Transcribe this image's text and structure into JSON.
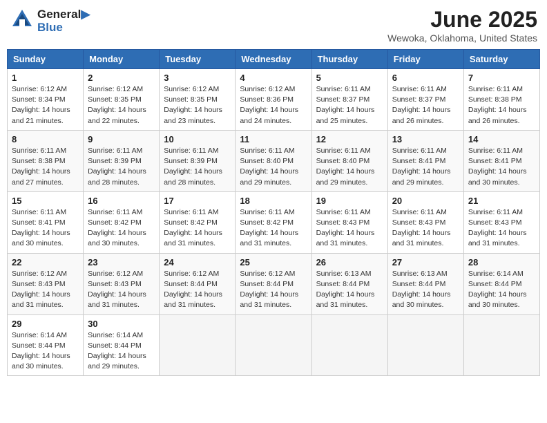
{
  "header": {
    "logo_line1": "General",
    "logo_line2": "Blue",
    "month_title": "June 2025",
    "location": "Wewoka, Oklahoma, United States"
  },
  "weekdays": [
    "Sunday",
    "Monday",
    "Tuesday",
    "Wednesday",
    "Thursday",
    "Friday",
    "Saturday"
  ],
  "weeks": [
    [
      {
        "day": "1",
        "info": "Sunrise: 6:12 AM\nSunset: 8:34 PM\nDaylight: 14 hours\nand 21 minutes."
      },
      {
        "day": "2",
        "info": "Sunrise: 6:12 AM\nSunset: 8:35 PM\nDaylight: 14 hours\nand 22 minutes."
      },
      {
        "day": "3",
        "info": "Sunrise: 6:12 AM\nSunset: 8:35 PM\nDaylight: 14 hours\nand 23 minutes."
      },
      {
        "day": "4",
        "info": "Sunrise: 6:12 AM\nSunset: 8:36 PM\nDaylight: 14 hours\nand 24 minutes."
      },
      {
        "day": "5",
        "info": "Sunrise: 6:11 AM\nSunset: 8:37 PM\nDaylight: 14 hours\nand 25 minutes."
      },
      {
        "day": "6",
        "info": "Sunrise: 6:11 AM\nSunset: 8:37 PM\nDaylight: 14 hours\nand 26 minutes."
      },
      {
        "day": "7",
        "info": "Sunrise: 6:11 AM\nSunset: 8:38 PM\nDaylight: 14 hours\nand 26 minutes."
      }
    ],
    [
      {
        "day": "8",
        "info": "Sunrise: 6:11 AM\nSunset: 8:38 PM\nDaylight: 14 hours\nand 27 minutes."
      },
      {
        "day": "9",
        "info": "Sunrise: 6:11 AM\nSunset: 8:39 PM\nDaylight: 14 hours\nand 28 minutes."
      },
      {
        "day": "10",
        "info": "Sunrise: 6:11 AM\nSunset: 8:39 PM\nDaylight: 14 hours\nand 28 minutes."
      },
      {
        "day": "11",
        "info": "Sunrise: 6:11 AM\nSunset: 8:40 PM\nDaylight: 14 hours\nand 29 minutes."
      },
      {
        "day": "12",
        "info": "Sunrise: 6:11 AM\nSunset: 8:40 PM\nDaylight: 14 hours\nand 29 minutes."
      },
      {
        "day": "13",
        "info": "Sunrise: 6:11 AM\nSunset: 8:41 PM\nDaylight: 14 hours\nand 29 minutes."
      },
      {
        "day": "14",
        "info": "Sunrise: 6:11 AM\nSunset: 8:41 PM\nDaylight: 14 hours\nand 30 minutes."
      }
    ],
    [
      {
        "day": "15",
        "info": "Sunrise: 6:11 AM\nSunset: 8:41 PM\nDaylight: 14 hours\nand 30 minutes."
      },
      {
        "day": "16",
        "info": "Sunrise: 6:11 AM\nSunset: 8:42 PM\nDaylight: 14 hours\nand 30 minutes."
      },
      {
        "day": "17",
        "info": "Sunrise: 6:11 AM\nSunset: 8:42 PM\nDaylight: 14 hours\nand 31 minutes."
      },
      {
        "day": "18",
        "info": "Sunrise: 6:11 AM\nSunset: 8:42 PM\nDaylight: 14 hours\nand 31 minutes."
      },
      {
        "day": "19",
        "info": "Sunrise: 6:11 AM\nSunset: 8:43 PM\nDaylight: 14 hours\nand 31 minutes."
      },
      {
        "day": "20",
        "info": "Sunrise: 6:11 AM\nSunset: 8:43 PM\nDaylight: 14 hours\nand 31 minutes."
      },
      {
        "day": "21",
        "info": "Sunrise: 6:11 AM\nSunset: 8:43 PM\nDaylight: 14 hours\nand 31 minutes."
      }
    ],
    [
      {
        "day": "22",
        "info": "Sunrise: 6:12 AM\nSunset: 8:43 PM\nDaylight: 14 hours\nand 31 minutes."
      },
      {
        "day": "23",
        "info": "Sunrise: 6:12 AM\nSunset: 8:43 PM\nDaylight: 14 hours\nand 31 minutes."
      },
      {
        "day": "24",
        "info": "Sunrise: 6:12 AM\nSunset: 8:44 PM\nDaylight: 14 hours\nand 31 minutes."
      },
      {
        "day": "25",
        "info": "Sunrise: 6:12 AM\nSunset: 8:44 PM\nDaylight: 14 hours\nand 31 minutes."
      },
      {
        "day": "26",
        "info": "Sunrise: 6:13 AM\nSunset: 8:44 PM\nDaylight: 14 hours\nand 31 minutes."
      },
      {
        "day": "27",
        "info": "Sunrise: 6:13 AM\nSunset: 8:44 PM\nDaylight: 14 hours\nand 30 minutes."
      },
      {
        "day": "28",
        "info": "Sunrise: 6:14 AM\nSunset: 8:44 PM\nDaylight: 14 hours\nand 30 minutes."
      }
    ],
    [
      {
        "day": "29",
        "info": "Sunrise: 6:14 AM\nSunset: 8:44 PM\nDaylight: 14 hours\nand 30 minutes."
      },
      {
        "day": "30",
        "info": "Sunrise: 6:14 AM\nSunset: 8:44 PM\nDaylight: 14 hours\nand 29 minutes."
      },
      null,
      null,
      null,
      null,
      null
    ]
  ]
}
